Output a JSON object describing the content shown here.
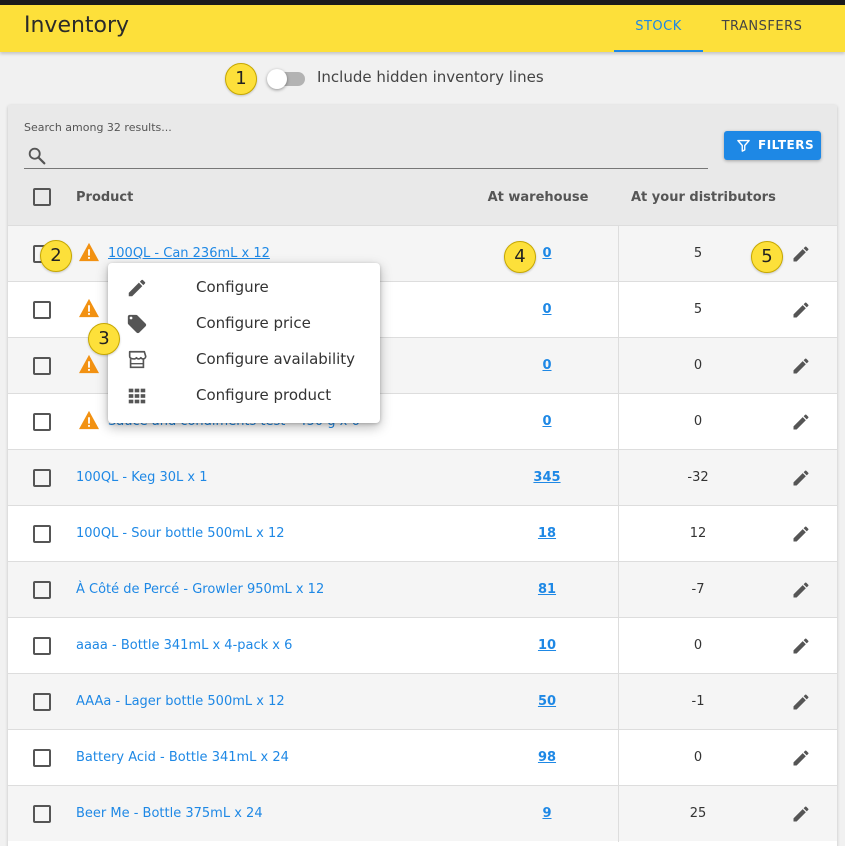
{
  "app": {
    "title": "Inventory"
  },
  "tabs": [
    {
      "label": "STOCK",
      "active": true
    },
    {
      "label": "TRANSFERS",
      "active": false
    }
  ],
  "toggle": {
    "label": "Include hidden inventory lines",
    "on": false
  },
  "search": {
    "hint": "Search among 32 results...",
    "value": ""
  },
  "filters": {
    "label": "FILTERS"
  },
  "table": {
    "headers": {
      "product": "Product",
      "warehouse": "At warehouse",
      "distributors": "At your distributors"
    },
    "rows": [
      {
        "product": "100QL - Can 236mL x 12",
        "warehouse": "0",
        "distributors": "5"
      },
      {
        "product": "",
        "warehouse": "0",
        "distributors": "5"
      },
      {
        "product": "",
        "warehouse": "0",
        "distributors": "0"
      },
      {
        "product": "Sauce and condiments test - 450 g x 6",
        "warehouse": "0",
        "distributors": "0"
      },
      {
        "product": "100QL - Keg 30L x 1",
        "warehouse": "345",
        "distributors": "-32"
      },
      {
        "product": "100QL - Sour bottle 500mL x 12",
        "warehouse": "18",
        "distributors": "12"
      },
      {
        "product": "À Côté de Percé - Growler 950mL x 12",
        "warehouse": "81",
        "distributors": "-7"
      },
      {
        "product": "aaaa - Bottle 341mL x 4-pack x 6",
        "warehouse": "10",
        "distributors": "0"
      },
      {
        "product": "AAAa - Lager bottle 500mL x 12",
        "warehouse": "50",
        "distributors": "-1"
      },
      {
        "product": "Battery Acid - Bottle 341mL x 24",
        "warehouse": "98",
        "distributors": "0"
      },
      {
        "product": "Beer Me - Bottle 375mL x 24",
        "warehouse": "9",
        "distributors": "25"
      }
    ]
  },
  "context_menu": {
    "items": [
      {
        "label": "Configure",
        "icon": "pencil-icon"
      },
      {
        "label": "Configure price",
        "icon": "tag-icon"
      },
      {
        "label": "Configure availability",
        "icon": "storefront-icon"
      },
      {
        "label": "Configure product",
        "icon": "grid-icon"
      }
    ]
  },
  "markers": [
    "1",
    "2",
    "3",
    "4",
    "5"
  ],
  "colors": {
    "topbar": "#fde03a",
    "accent": "#1e88e5",
    "warning": "#f29111"
  }
}
